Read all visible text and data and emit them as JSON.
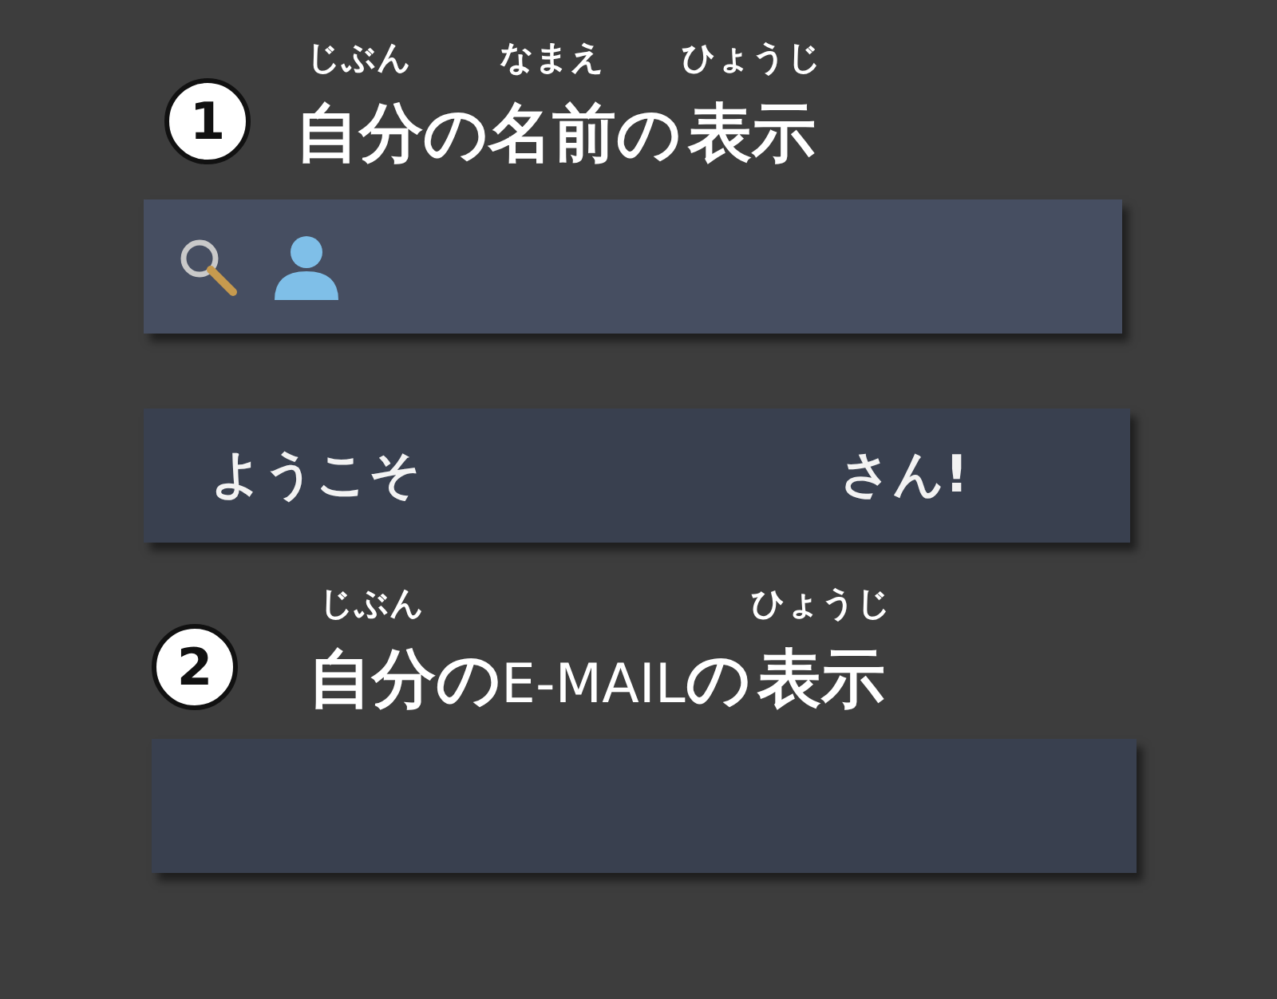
{
  "sections": [
    {
      "number": "1",
      "heading": [
        {
          "text": "自分",
          "ruby": "じぶん",
          "kind": "bold"
        },
        {
          "text": "の",
          "kind": "bold"
        },
        {
          "text": "名前",
          "ruby": "なまえ",
          "kind": "bold"
        },
        {
          "text": "の",
          "kind": "bold"
        },
        {
          "text": "表示",
          "ruby": "ひょうじ",
          "kind": "bold"
        }
      ]
    },
    {
      "number": "2",
      "heading": [
        {
          "text": "自分",
          "ruby": "じぶん",
          "kind": "bold"
        },
        {
          "text": "の",
          "kind": "bold"
        },
        {
          "text": "E-MAIL",
          "kind": "light"
        },
        {
          "text": "の",
          "kind": "bold"
        },
        {
          "text": "表示",
          "ruby": "ひょうじ",
          "kind": "bold"
        }
      ]
    }
  ],
  "welcome": {
    "greeting": "ようこそ",
    "suffix": "さん!"
  }
}
